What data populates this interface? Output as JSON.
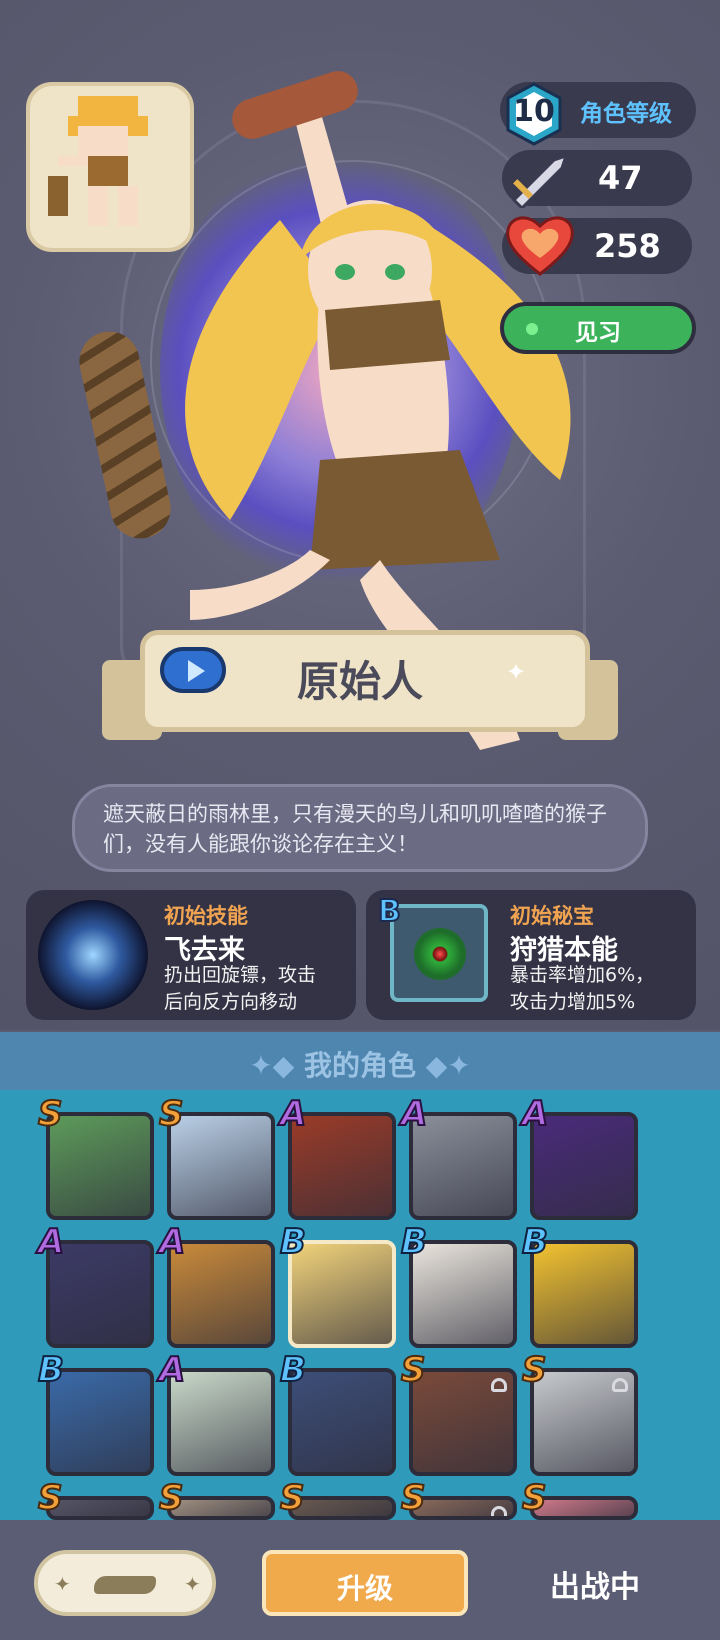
{
  "character": {
    "level": "10",
    "level_label": "角色等级",
    "attack": "47",
    "hp": "258",
    "status": "见习",
    "name": "原始人",
    "description": "遮天蔽日的雨林里，只有漫天的鸟儿和叽叽喳喳的猴子们，没有人能跟你谈论存在主义！"
  },
  "skill": {
    "title": "初始技能",
    "name": "飞去来",
    "desc_line1": "扔出回旋镖，攻击",
    "desc_line2": "后向反方向移动"
  },
  "treasure": {
    "rank": "B",
    "title": "初始秘宝",
    "name": "狩猎本能",
    "desc_line1": "暴击率增加6%，",
    "desc_line2": "攻击力增加5%"
  },
  "roster": {
    "title": "我的角色",
    "tiles": [
      {
        "rank": "S",
        "color": "#5d9a5a",
        "locked": false
      },
      {
        "rank": "S",
        "color": "#b9cfe6",
        "locked": false
      },
      {
        "rank": "A",
        "color": "#9a3b28",
        "locked": false
      },
      {
        "rank": "A",
        "color": "#8a8f9a",
        "locked": false
      },
      {
        "rank": "A",
        "color": "#4a2b7a",
        "locked": false
      },
      {
        "rank": "A",
        "color": "#3c3a66",
        "locked": false
      },
      {
        "rank": "A",
        "color": "#c98a3a",
        "locked": false
      },
      {
        "rank": "B",
        "color": "#f1d27a",
        "locked": false,
        "selected": true
      },
      {
        "rank": "B",
        "color": "#e9e4dc",
        "locked": false
      },
      {
        "rank": "B",
        "color": "#f2c230",
        "locked": false
      },
      {
        "rank": "B",
        "color": "#3a6aa8",
        "locked": false
      },
      {
        "rank": "A",
        "color": "#c8d8c8",
        "locked": false
      },
      {
        "rank": "B",
        "color": "#3d4e78",
        "locked": false
      },
      {
        "rank": "S",
        "color": "#7a4a3a",
        "locked": true
      },
      {
        "rank": "S",
        "color": "#c6c9cc",
        "locked": true
      },
      {
        "rank": "S",
        "color": "#555566",
        "locked": false
      },
      {
        "rank": "S",
        "color": "#a09080",
        "locked": false
      },
      {
        "rank": "S",
        "color": "#6a5a50",
        "locked": false
      },
      {
        "rank": "S",
        "color": "#8a6a5a",
        "locked": true
      },
      {
        "rank": "S",
        "color": "#d07a8a",
        "locked": false
      }
    ]
  },
  "actions": {
    "upgrade": "升级",
    "deployed": "出战中"
  },
  "icons": {
    "sword": "sword-icon",
    "heart": "heart-icon",
    "play": "play-icon",
    "sparkle": "✦",
    "skin": "skin-icon"
  },
  "colors": {
    "accent_orange": "#f0a94b",
    "status_green": "#3cb35a",
    "rank_s": "#f2a03a",
    "rank_a": "#b06be0",
    "rank_b": "#5ec2ff"
  }
}
